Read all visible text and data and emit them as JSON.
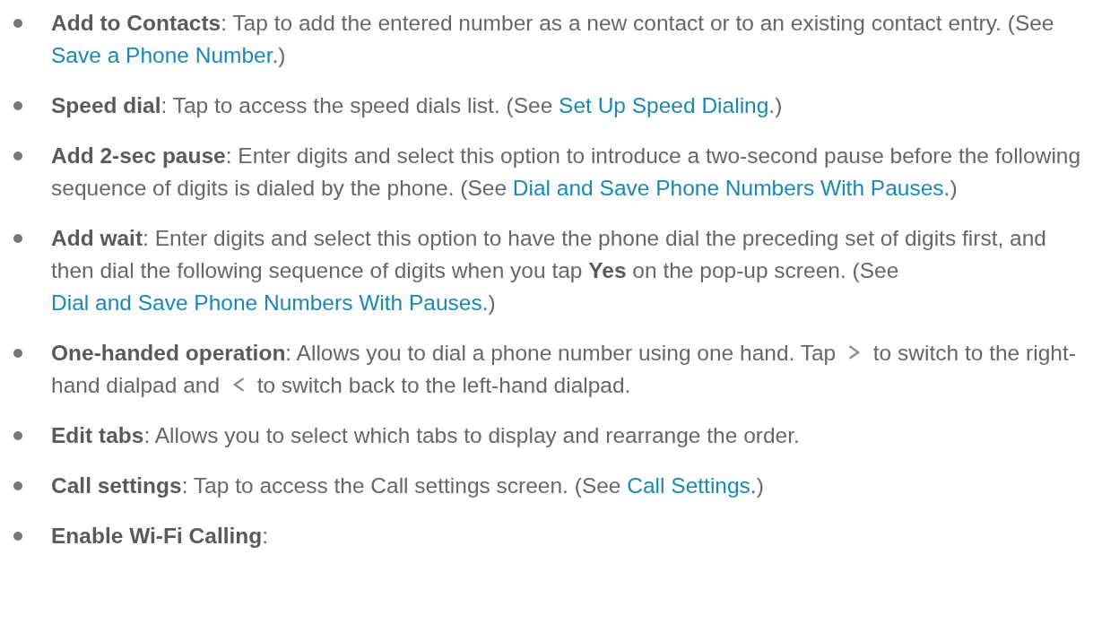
{
  "items": [
    {
      "segments": [
        {
          "kind": "text",
          "text": "**Add to Contacts**: Tap to add the entered number as a new contact or to an existing contact entry. (See "
        },
        {
          "kind": "link",
          "text": "Save a Phone Number"
        },
        {
          "kind": "text",
          "text": ".)"
        }
      ]
    },
    {
      "segments": [
        {
          "kind": "text",
          "text": "**Speed dial**: Tap to access the speed dials list. (See "
        },
        {
          "kind": "link",
          "text": "Set Up Speed Dialing"
        },
        {
          "kind": "text",
          "text": ".)"
        }
      ]
    },
    {
      "segments": [
        {
          "kind": "text",
          "text": "**Add 2-sec pause**: Enter digits and select this option to introduce a two-second pause before the following sequence of digits is dialed by the phone. (See "
        },
        {
          "kind": "link",
          "text": "Dial and Save Phone Numbers With Pauses"
        },
        {
          "kind": "text",
          "text": ".)"
        }
      ]
    },
    {
      "segments": [
        {
          "kind": "text",
          "text": "**Add wait**: Enter digits and select this option to have the phone dial the preceding set of digits first, and then dial the following sequence of digits when you tap **Yes** on the pop-up screen. (See "
        },
        {
          "kind": "link",
          "text": "Dial and Save Phone Numbers With Pauses"
        },
        {
          "kind": "text",
          "text": ".)"
        }
      ]
    },
    {
      "segments": [
        {
          "kind": "text",
          "text": "**One-handed operation**: Allows you to dial a phone number using one hand. Tap "
        },
        {
          "kind": "next-icon"
        },
        {
          "kind": "text",
          "text": " to switch to the right-hand dialpad and "
        },
        {
          "kind": "back-icon"
        },
        {
          "kind": "text",
          "text": " to switch back to the left-hand dialpad."
        }
      ]
    },
    {
      "segments": [
        {
          "kind": "text",
          "text": "**Edit tabs**: Allows you to select which tabs to display and rearrange the order."
        }
      ]
    },
    {
      "segments": [
        {
          "kind": "text",
          "text": "**Call settings**: Tap to access the Call settings screen. (See "
        },
        {
          "kind": "link",
          "text": "Call Settings"
        },
        {
          "kind": "text",
          "text": ".)"
        }
      ]
    },
    {
      "segments": [
        {
          "kind": "text",
          "text": "**Enable Wi-Fi Calling**:"
        }
      ]
    }
  ]
}
